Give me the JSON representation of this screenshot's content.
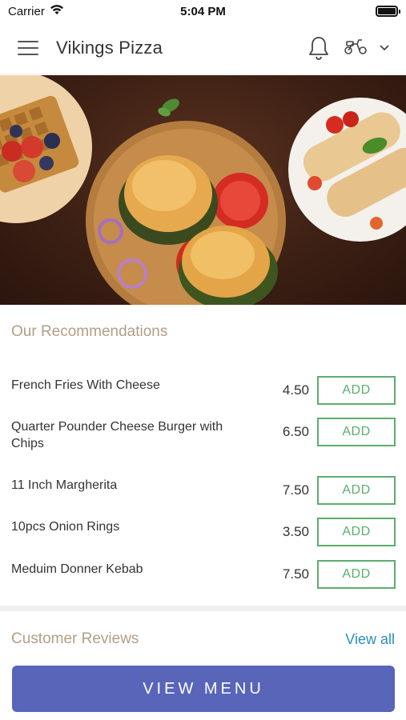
{
  "status_bar": {
    "carrier": "Carrier",
    "time": "5:04 PM"
  },
  "header": {
    "title": "Vikings Pizza",
    "menu_icon": "hamburger-menu-icon",
    "notification_icon": "bell-icon",
    "delivery_icon": "scooter-icon",
    "dropdown_icon": "chevron-down-icon"
  },
  "hero": {
    "image": "food-banner-burgers-waffles-wraps"
  },
  "recommendations": {
    "title": "Our Recommendations",
    "items": [
      {
        "name": "French Fries With Cheese",
        "price": "4.50",
        "button": "ADD"
      },
      {
        "name": "Quarter Pounder Cheese Burger with Chips",
        "price": "6.50",
        "button": "ADD"
      },
      {
        "name": "11 Inch Margherita",
        "price": "7.50",
        "button": "ADD"
      },
      {
        "name": "10pcs Onion Rings",
        "price": "3.50",
        "button": "ADD"
      },
      {
        "name": "Meduim Donner Kebab",
        "price": "7.50",
        "button": "ADD"
      }
    ]
  },
  "reviews": {
    "title": "Customer Reviews",
    "view_all": "View all"
  },
  "footer": {
    "view_menu": "VIEW MENU"
  },
  "colors": {
    "accent_green": "#5cad6e",
    "section_title": "#b29e86",
    "link_blue": "#2a8fc0",
    "primary_button": "#5865b9"
  }
}
